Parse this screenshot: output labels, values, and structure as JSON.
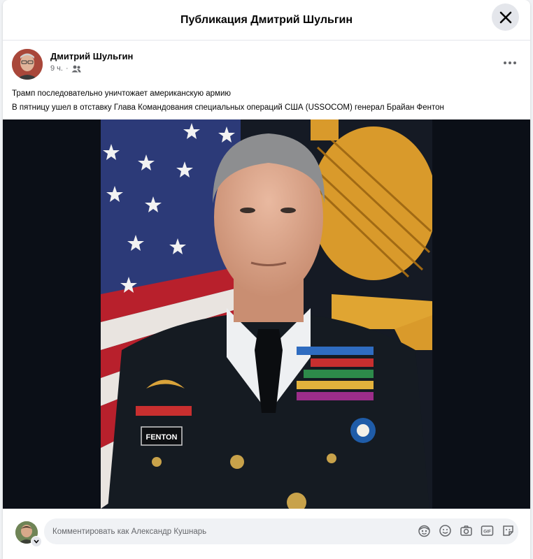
{
  "dialog": {
    "title": "Публикация Дмитрий Шульгин"
  },
  "post": {
    "author": "Дмитрий Шульгин",
    "time": "9 ч.",
    "separator": "·",
    "audience_icon": "friends-icon",
    "lines": [
      "Трамп последовательно уничтожает американскую армию",
      "В пятницу ушел в отставку Глава Командования специальных операций США (USSOCOM) генерал Брайан Фентон"
    ],
    "photo": {
      "nametag": "FENTON",
      "background_color": "#0b0f17"
    }
  },
  "comment": {
    "placeholder": "Комментировать как Александр Кушнарь",
    "icons": [
      "avatar-sticker-icon",
      "emoji-icon",
      "camera-icon",
      "gif-icon",
      "sticker-icon"
    ]
  },
  "colors": {
    "accent_gray": "#e4e6eb",
    "secondary_text": "#65676b",
    "input_bg": "#f0f2f5"
  }
}
